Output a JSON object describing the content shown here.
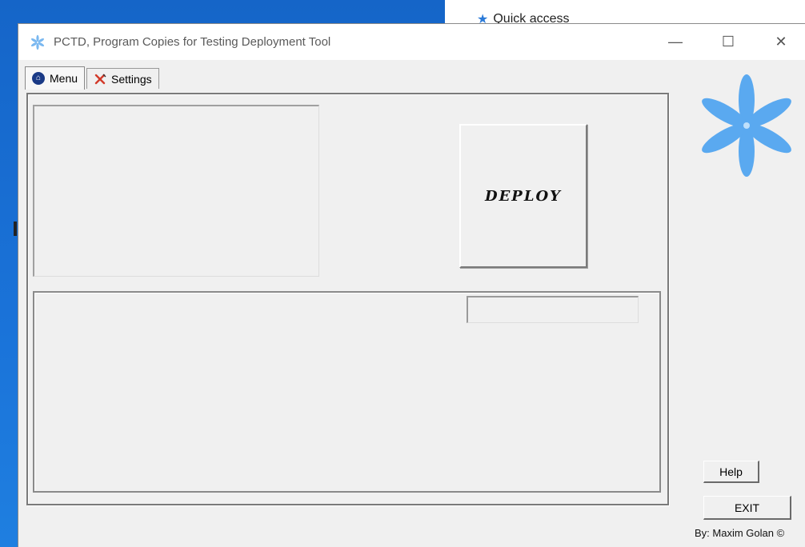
{
  "desktop": {
    "quick_access_label": "Quick access",
    "quick_access_icon": "star-icon"
  },
  "window": {
    "title": "PCTD, Program Copies for Testing Deployment Tool",
    "app_icon": "asterisk-logo-icon",
    "controls": {
      "minimize": "—",
      "maximize": "☐",
      "close": "✕"
    }
  },
  "tabs": [
    {
      "label": "Menu",
      "icon": "home-icon",
      "active": true
    },
    {
      "label": "Settings",
      "icon": "tools-icon",
      "active": false
    }
  ],
  "main": {
    "deploy_label": "DEPLOY",
    "status_value": ""
  },
  "side": {
    "logo_icon": "asterisk-logo-icon",
    "help_label": "Help",
    "exit_label": "EXIT",
    "credit": "By: Maxim Golan ©"
  },
  "colors": {
    "logo": "#5aa9f0",
    "window_bg": "#f0f0f0",
    "desktop": "#1a73d9"
  }
}
